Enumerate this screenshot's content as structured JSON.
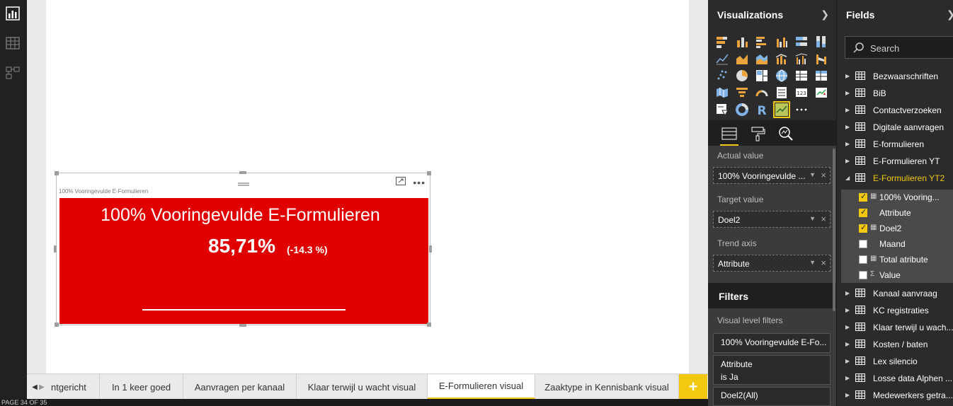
{
  "visual": {
    "header_title": "100% Vooringevulde E-Formulieren",
    "kpi_title": "100% Vooringevulde E-Formulieren",
    "kpi_value": "85,71%",
    "kpi_delta": "(-14.3 %)",
    "kpi_color": "#e00000"
  },
  "tabs": {
    "items": [
      {
        "label": "ntgericht"
      },
      {
        "label": "In 1 keer goed"
      },
      {
        "label": "Aanvragen per kanaal"
      },
      {
        "label": "Klaar terwijl u wacht visual"
      },
      {
        "label": "E-Formulieren visual"
      },
      {
        "label": "Zaaktype in Kennisbank visual"
      }
    ],
    "active_index": 4,
    "add_label": "+"
  },
  "status": {
    "text": "PAGE 34 OF 35"
  },
  "visualizations": {
    "title": "Visualizations",
    "wells": [
      {
        "label": "Actual value",
        "value": "100% Vooringevulde ..."
      },
      {
        "label": "Target value",
        "value": "Doel2"
      },
      {
        "label": "Trend axis",
        "value": "Attribute"
      }
    ]
  },
  "filters": {
    "title": "Filters",
    "level_label": "Visual level filters",
    "items": [
      {
        "line1": "100% Vooringevulde E-Fo...",
        "line2": ""
      },
      {
        "line1": "Attribute",
        "line2": "is Ja"
      },
      {
        "line1": "Doel2(All)",
        "line2": ""
      }
    ]
  },
  "fields": {
    "title": "Fields",
    "search_placeholder": "Search",
    "tables_top": [
      {
        "label": "Bezwaarschriften"
      },
      {
        "label": "BiB"
      },
      {
        "label": "Contactverzoeken"
      },
      {
        "label": "Digitale aanvragen"
      },
      {
        "label": "E-formulieren"
      },
      {
        "label": "E-Formulieren YT"
      },
      {
        "label": "E-Formulieren YT2"
      }
    ],
    "expanded_fields": [
      {
        "label": "100% Vooring...",
        "checked": true,
        "type": "calc"
      },
      {
        "label": "Attribute",
        "checked": true,
        "type": ""
      },
      {
        "label": "Doel2",
        "checked": true,
        "type": "calc"
      },
      {
        "label": "Maand",
        "checked": false,
        "type": ""
      },
      {
        "label": "Total atribute",
        "checked": false,
        "type": "calc"
      },
      {
        "label": "Value",
        "checked": false,
        "type": "sum"
      }
    ],
    "tables_bottom": [
      {
        "label": "Kanaal aanvraag"
      },
      {
        "label": "KC registraties"
      },
      {
        "label": "Klaar terwijl u wach..."
      },
      {
        "label": "Kosten / baten"
      },
      {
        "label": "Lex silencio"
      },
      {
        "label": "Losse data Alphen ..."
      },
      {
        "label": "Medewerkers getra..."
      }
    ]
  },
  "colors": {
    "accent": "#f2c811",
    "pane_bg": "#2b2b2b",
    "rail_bg": "#212121"
  }
}
